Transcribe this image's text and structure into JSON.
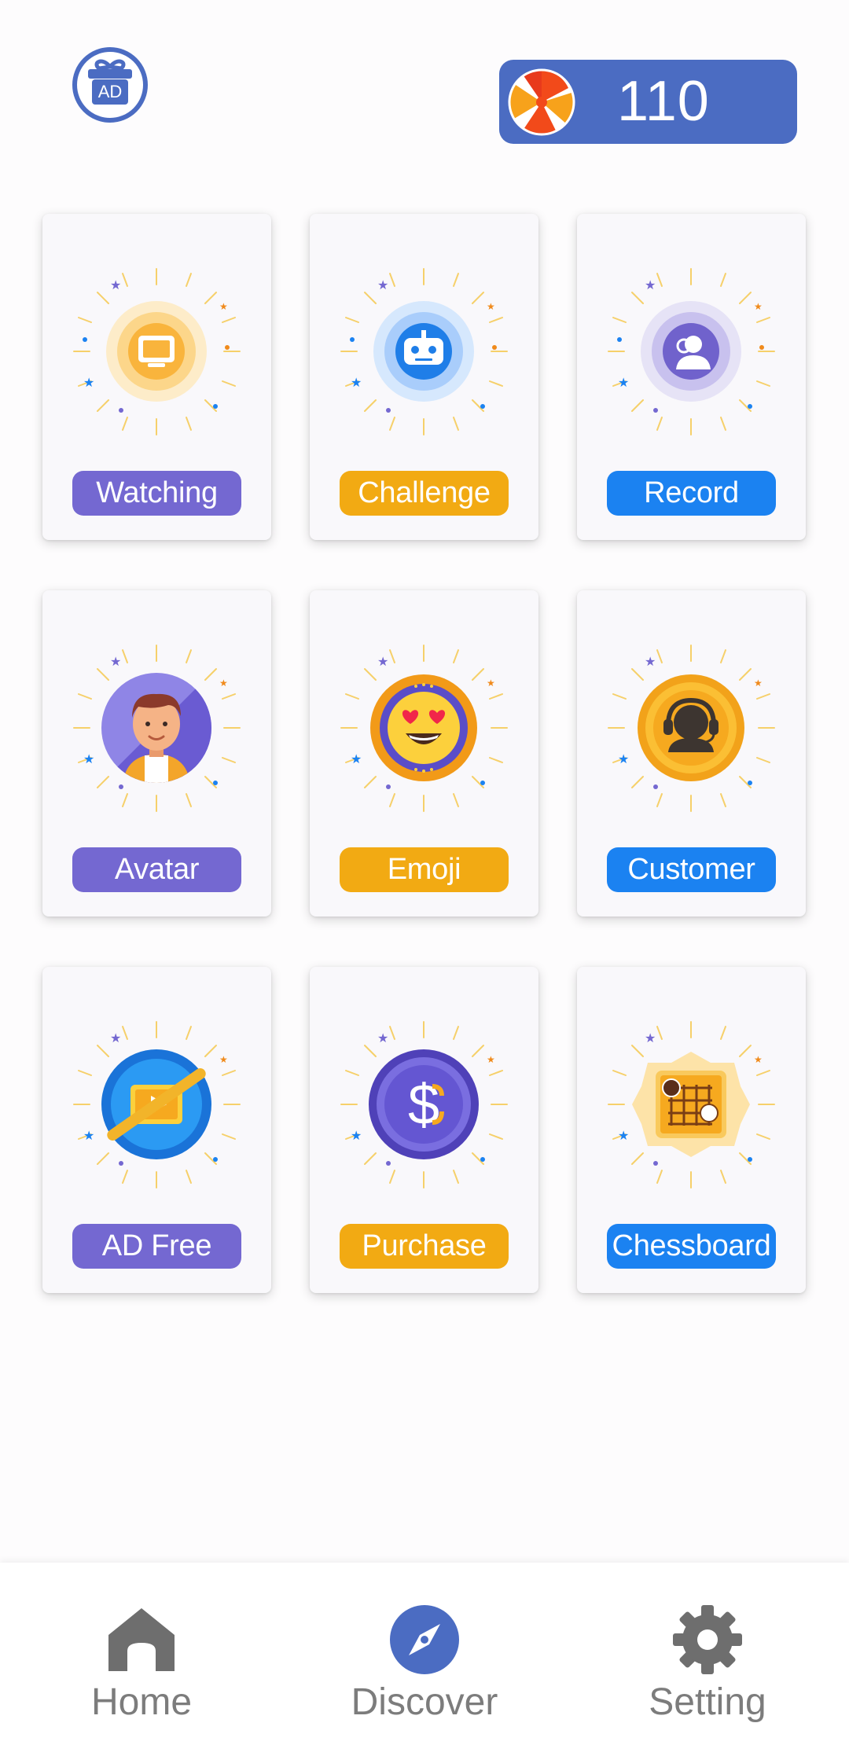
{
  "header": {
    "ad_badge": "AD",
    "coin_icon": "candy-icon",
    "coin_count": "110"
  },
  "features": [
    {
      "label": "Watching",
      "icon": "tv-icon",
      "color": "#7468d1"
    },
    {
      "label": "Challenge",
      "icon": "robot-icon",
      "color": "#f2aa13"
    },
    {
      "label": "Record",
      "icon": "user-record-icon",
      "color": "#1b82f1"
    },
    {
      "label": "Avatar",
      "icon": "avatar-boy-icon",
      "color": "#7468d1"
    },
    {
      "label": "Emoji",
      "icon": "heart-eyes-emoji-icon",
      "color": "#f2aa13"
    },
    {
      "label": "Customer",
      "icon": "headset-icon",
      "color": "#1b82f1"
    },
    {
      "label": "AD Free",
      "icon": "ad-free-video-icon",
      "color": "#7468d1"
    },
    {
      "label": "Purchase",
      "icon": "dollar-coin-icon",
      "color": "#f2aa13"
    },
    {
      "label": "Chessboard",
      "icon": "go-board-icon",
      "color": "#1b82f1"
    }
  ],
  "nav": {
    "items": [
      {
        "label": "Home",
        "icon": "home-icon"
      },
      {
        "label": "Discover",
        "icon": "compass-icon",
        "active": true
      },
      {
        "label": "Setting",
        "icon": "gear-icon"
      }
    ]
  },
  "colors": {
    "accent_blue": "#4b6cc2",
    "purple": "#7468d1",
    "orange": "#f2aa13",
    "blue": "#1b82f1",
    "nav_gray": "#7c7c7c"
  }
}
